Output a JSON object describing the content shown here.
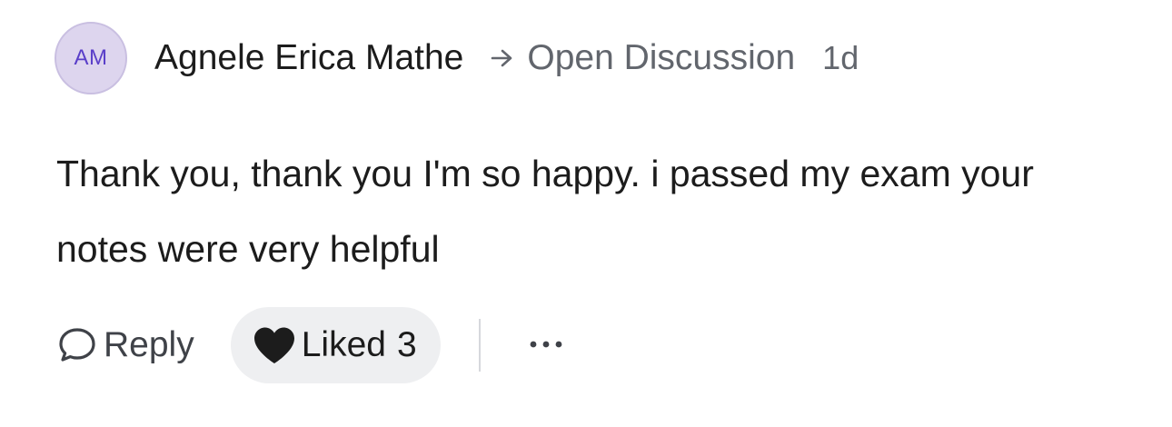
{
  "post": {
    "avatar_initials": "AM",
    "author_name": "Agnele Erica Mathe",
    "space_name": "Open Discussion",
    "time_ago": "1d",
    "body": "Thank you, thank you I'm so happy. i passed my exam your notes were very helpful"
  },
  "actions": {
    "reply_label": "Reply",
    "like_label": "Liked",
    "like_count": "3"
  },
  "icons": {
    "arrow": "arrow-right-icon",
    "reply": "speech-bubble-icon",
    "like": "heart-filled-icon",
    "more": "more-horizontal-icon"
  },
  "colors": {
    "avatar_bg": "#ddd5ee",
    "avatar_text": "#5a3fc9",
    "muted_text": "#62666d",
    "like_pill_bg": "#eeeff1"
  }
}
